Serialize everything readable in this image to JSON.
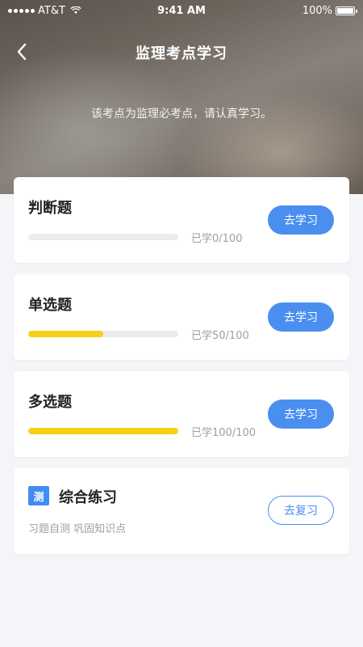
{
  "status_bar": {
    "carrier": "AT&T",
    "time": "9:41 AM",
    "battery": "100%"
  },
  "nav": {
    "title": "监理考点学习",
    "back_icon": "chevron-left-icon"
  },
  "subtitle": "该考点为监理必考点，请认真学习。",
  "colors": {
    "accent": "#4a8ff0",
    "progress": "#f7cf14",
    "track": "#ececee",
    "background": "#f4f5f8"
  },
  "cards": [
    {
      "title": "判断题",
      "progress_text": "已学0/100",
      "learned": 0,
      "total": 100,
      "button": "去学习"
    },
    {
      "title": "单选题",
      "progress_text": "已学50/100",
      "learned": 50,
      "total": 100,
      "button": "去学习"
    },
    {
      "title": "多选题",
      "progress_text": "已学100/100",
      "learned": 100,
      "total": 100,
      "button": "去学习"
    }
  ],
  "practice": {
    "badge": "测",
    "title": "综合练习",
    "description": "习题自测 巩固知识点",
    "button": "去复习"
  }
}
